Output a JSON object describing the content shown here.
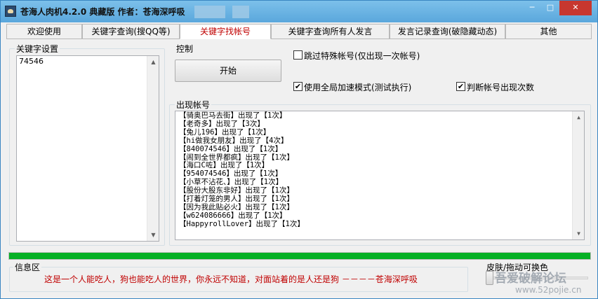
{
  "window": {
    "title": "苍海人肉机4.2.0  典藏版  作者：苍海深呼吸",
    "minimize_glyph": "─",
    "maximize_glyph": "□",
    "close_glyph": "✕"
  },
  "tabs": [
    {
      "label": "欢迎使用"
    },
    {
      "label": "关键字查询(搜QQ等)"
    },
    {
      "label": "关键字找帐号"
    },
    {
      "label": "关键字查询所有人发言"
    },
    {
      "label": "发言记录查询(破隐藏动态)"
    },
    {
      "label": "其他"
    }
  ],
  "active_tab_index": 2,
  "keyword_group": {
    "label": "关键字设置",
    "value": "74546"
  },
  "control": {
    "label": "控制",
    "start_button": "开始"
  },
  "options": {
    "skip_special": {
      "label": "跳过特殊帐号(仅出现一次帐号)",
      "checked": false
    },
    "global_accel": {
      "label": "使用全局加速模式(测试执行)",
      "checked": true
    },
    "judge_count": {
      "label": "判断帐号出现次数",
      "checked": true
    }
  },
  "results": {
    "label": "出现帐号",
    "lines": [
      "【骑奥巴马去街】出现了【1次】",
      "【老奇多】出现了【3次】",
      "【兔儿196】出现了【1次】",
      "【hi做我女朋友】出现了【4次】",
      "【840074546】出现了【1次】",
      "【闹到全世界都疯】出现了【1次】",
      "【海口C咗】出现了【1次】",
      "【954074546】出现了【1次】",
      "【小草不沾花、】出现了【1次】",
      "【股份大股东非好】出现了【1次】",
      "【打着灯笼的男人】出现了【1次】",
      "【因为我此贴必火】出现了【1次】",
      "【w624086666】出现了【1次】",
      "【HappyrollLover】出现了【1次】"
    ]
  },
  "progress": {
    "percent": 100,
    "color": "#06b025"
  },
  "info": {
    "label": "信息区",
    "message": "这是一个人能吃人，狗也能吃人的世界，你永远不知道，对面站着的是人还是狗      －－－－苍海深呼吸"
  },
  "skin": {
    "label": "皮肤/拖动可换色"
  },
  "watermark": {
    "text": "吾爱破解论坛",
    "url": "www.52pojie.cn"
  },
  "icons": {
    "app": "app-icon",
    "scroll_up": "▲",
    "scroll_down": "▼",
    "check": "✔"
  }
}
